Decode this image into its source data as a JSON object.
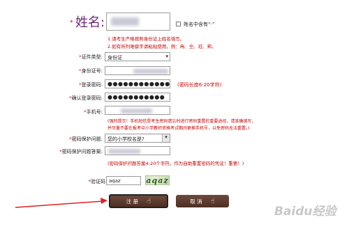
{
  "form": {
    "name": {
      "label": "姓名:",
      "checkbox_label": "姓名中含有“·”",
      "notes": [
        "1.请考生严格按照身份证上姓名填写。",
        "2.如有所列难僻字请粘贴使用，例：冉、仝、珏、邦。"
      ]
    },
    "cert_type": {
      "label": "证件类型:",
      "value": "身份证"
    },
    "id_number": {
      "label": "身份证号:",
      "value": ""
    },
    "password": {
      "label": "登录密码:",
      "value": "●●●●●●●●●●●●●",
      "hint": "(密码长度6-20字符)"
    },
    "confirm_password": {
      "label": "确认登录密码:",
      "value": "●●●●●●●●●●●"
    },
    "phone": {
      "label": "手机号:",
      "value": "",
      "hint_lines": [
        "(强烈提示！手机短信是考生密码遗忘时进行密码重置的重要途径，请准确填写，",
        "并尽量不要在报考中小学教师资格考试期间更换手机号，以免密码无法重置。)"
      ]
    },
    "security_question": {
      "label": "密码保护问题:",
      "value": "您的小学校名是?"
    },
    "security_answer": {
      "label": "密码保护问题答案:",
      "value": "",
      "hint": "(密码保护问题答案4-20个字符，作为自助重置密码的凭证！重要！)"
    },
    "captcha": {
      "label": "验证码",
      "value": "aqaz",
      "image_text": "aqaz"
    }
  },
  "buttons": {
    "register": "注 册",
    "cancel": "取 消"
  },
  "watermark": "Baidu经验"
}
